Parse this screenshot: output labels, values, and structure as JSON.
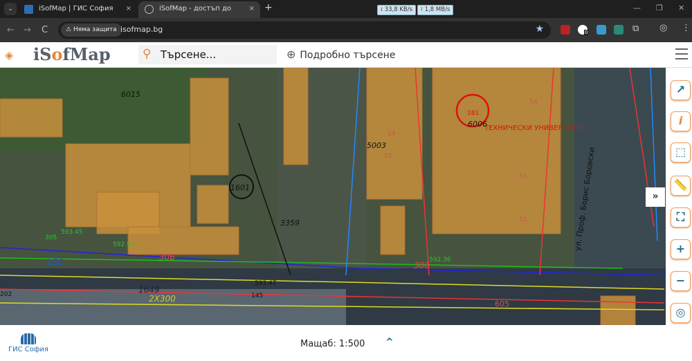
{
  "browser": {
    "tabs": [
      {
        "title": "iSofMap | ГИС София",
        "close": "×"
      },
      {
        "title": "iSofMap - достъп до цифрови",
        "close": "×"
      }
    ],
    "new_tab": "+",
    "download_speed": "33,8 KB/s",
    "upload_speed": "1,8 MB/s",
    "security_label": "Няма защита",
    "url": "isofmap.bg",
    "extension_badge": "0"
  },
  "app": {
    "logo": {
      "pre": "iS",
      "o": "o",
      "post": "fMap"
    },
    "search_placeholder": "Търсене...",
    "advanced_search": "Подробно търсене",
    "accent": "#e8873a",
    "tool_color": "#1b6e8a"
  },
  "map": {
    "labels": [
      "6015",
      "1601",
      "3359",
      "5003",
      "6006",
      "ТЕХНИЧЕСКИ УНИВЕРСИТЕТ",
      "181",
      "ул. Проф. Борис Боровски",
      "593.45",
      "592.95",
      "305",
      "15С",
      "306",
      "306",
      "1649",
      "2Х300",
      "592.36",
      "145",
      "593.47",
      "54",
      "53",
      "52",
      "24",
      "25",
      "605",
      "202"
    ]
  },
  "toolbar": {
    "icons": [
      "external-link-icon",
      "info-icon",
      "select-area-icon",
      "measure-ruler-icon",
      "fullscreen-icon",
      "zoom-in-icon",
      "zoom-out-icon",
      "locate-icon"
    ],
    "expand": "»"
  },
  "footer": {
    "gis_logo": "ГИС София",
    "scale": "Мащаб: 1:500",
    "chevron": "^"
  }
}
